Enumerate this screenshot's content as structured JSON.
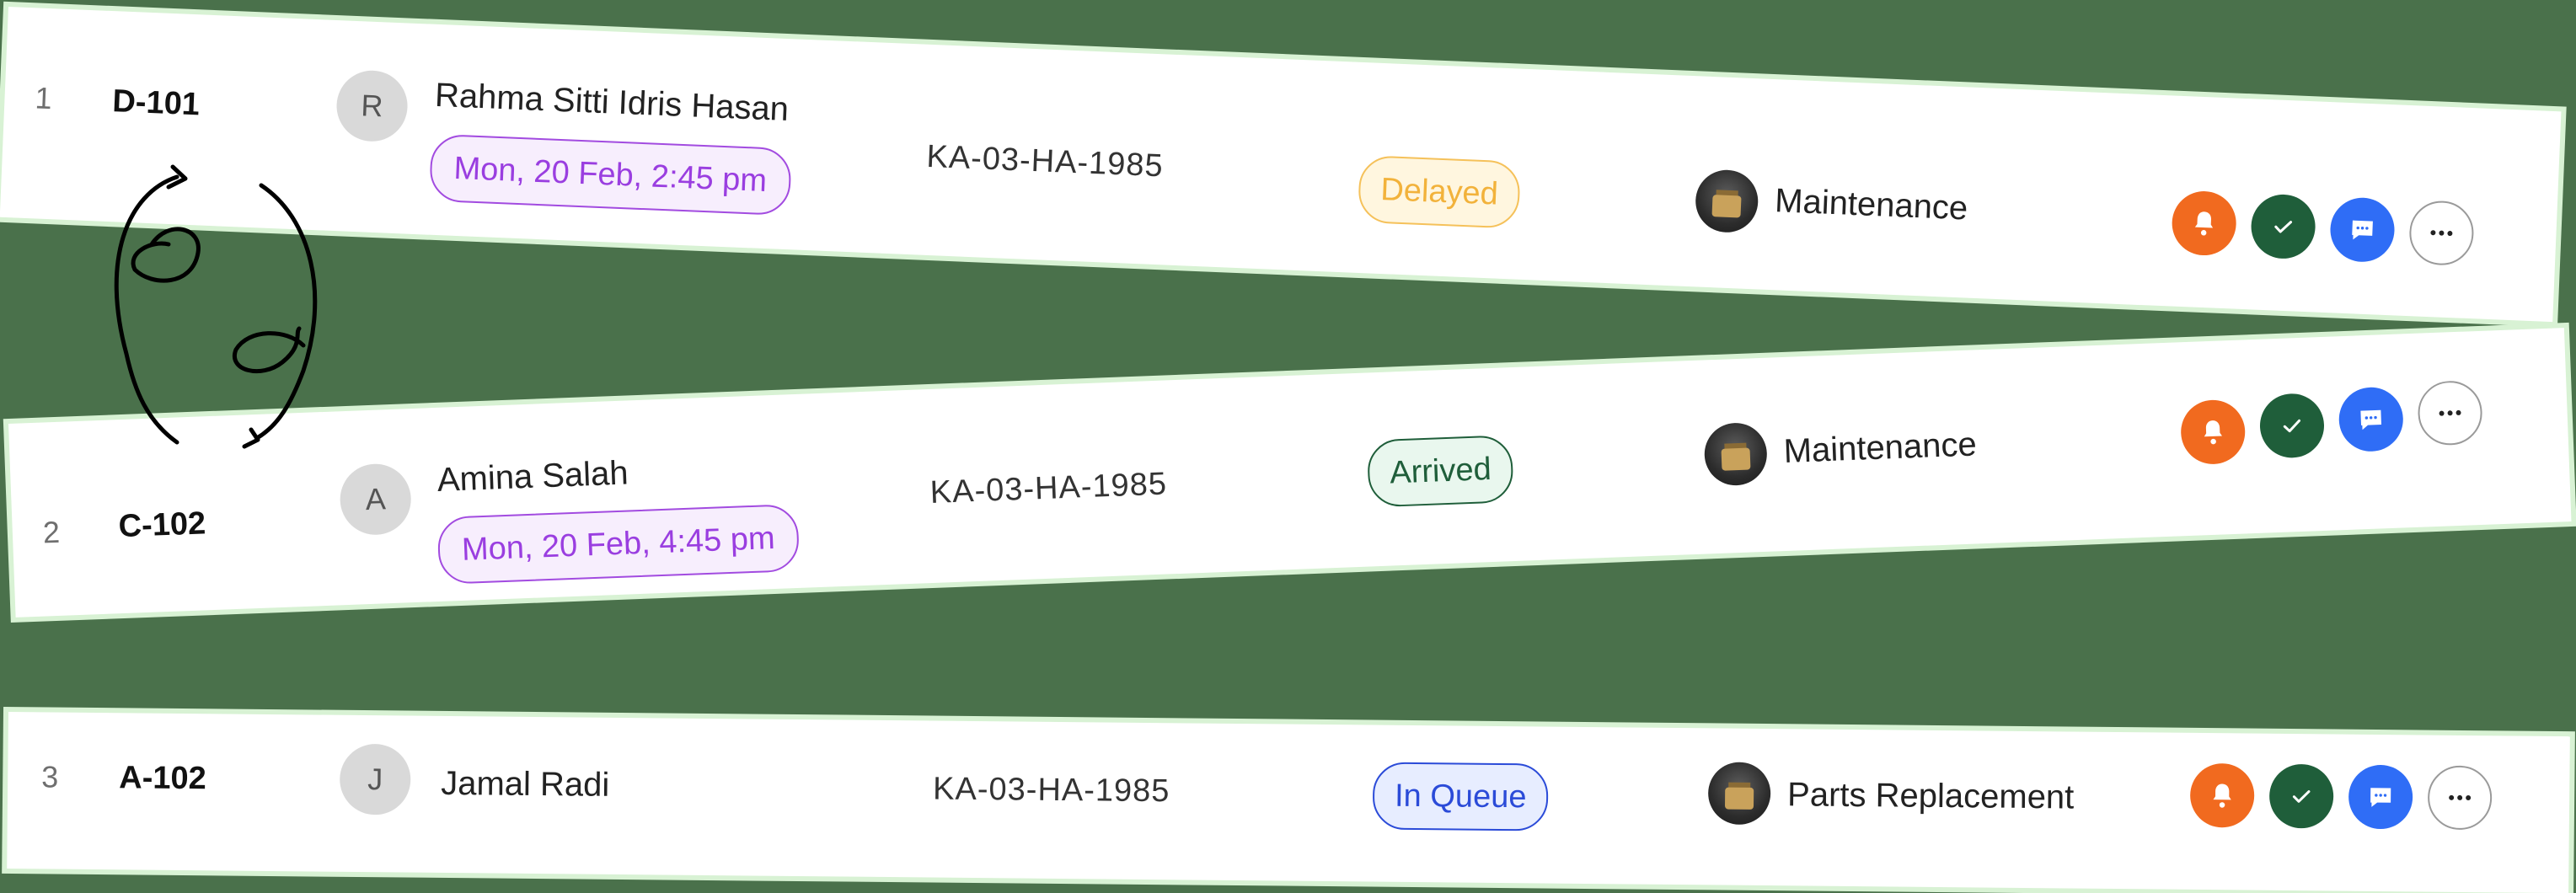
{
  "rows": [
    {
      "index": "1",
      "code": "D-101",
      "avatar_initial": "R",
      "name": "Rahma Sitti Idris Hasan",
      "date": "Mon, 20 Feb, 2:45 pm",
      "plate": "KA-03-HA-1985",
      "status": "Delayed",
      "service": "Maintenance"
    },
    {
      "index": "2",
      "code": "C-102",
      "avatar_initial": "A",
      "name": "Amina Salah",
      "date": "Mon, 20 Feb, 4:45 pm",
      "plate": "KA-03-HA-1985",
      "status": "Arrived",
      "service": "Maintenance"
    },
    {
      "index": "3",
      "code": "A-102",
      "avatar_initial": "J",
      "name": "Jamal Radi",
      "plate": "KA-03-HA-1985",
      "status": "In Queue",
      "service": "Parts Replacement"
    }
  ],
  "actions": {
    "notify_icon": "bell-icon",
    "approve_icon": "check-icon",
    "message_icon": "chat-icon",
    "more_icon": "more-horizontal-icon"
  },
  "colors": {
    "background": "#4a714b",
    "card": "#ffffff",
    "date_pill": "#9a3ee0",
    "status_delayed": "#f2b23b",
    "status_arrived": "#1f5e3a",
    "status_in_queue": "#2b4bd8",
    "action_notify": "#f16a1f",
    "action_approve": "#1f5e3a",
    "action_message": "#2f6df6"
  }
}
